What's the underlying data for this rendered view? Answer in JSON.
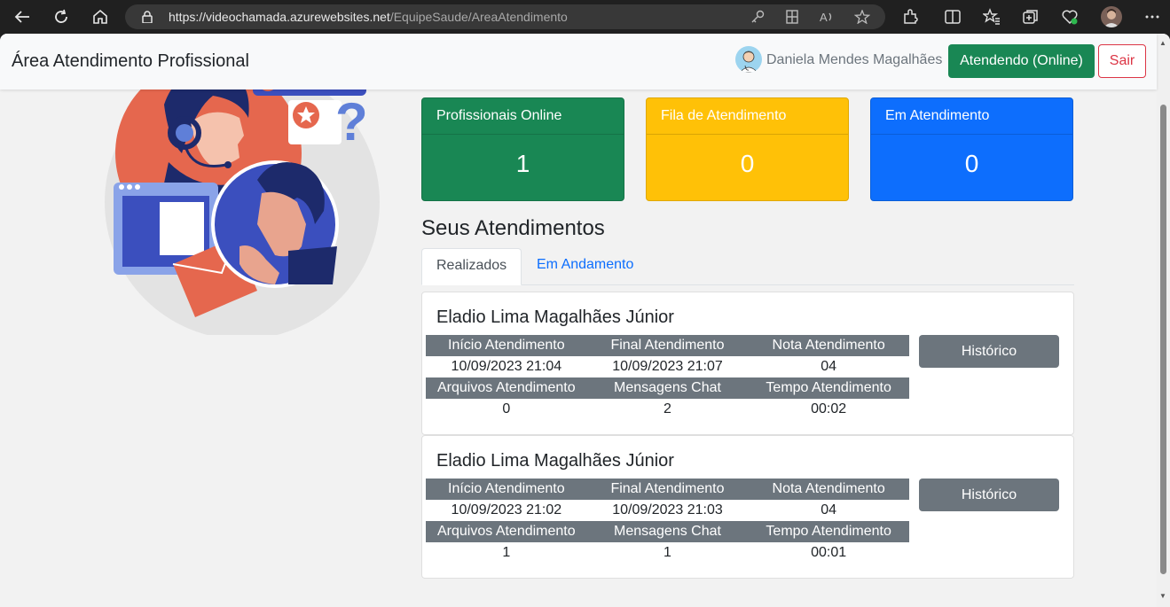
{
  "browser": {
    "url_host": "https://videochamada.azurewebsites.net",
    "url_path": "/EquipeSaude/AreaAtendimento"
  },
  "navbar": {
    "brand": "Área Atendimento Profissional",
    "user_name": "Daniela Mendes Magalhães",
    "status_button": "Atendendo (Online)",
    "logout_button": "Sair"
  },
  "stats": [
    {
      "label": "Profissionais Online",
      "value": "1",
      "color": "#198754"
    },
    {
      "label": "Fila de Atendimento",
      "value": "0",
      "color": "#ffc107"
    },
    {
      "label": "Em Atendimento",
      "value": "0",
      "color": "#0d6efd"
    }
  ],
  "section_title": "Seus Atendimentos",
  "tabs": [
    {
      "label": "Realizados",
      "active": true
    },
    {
      "label": "Em Andamento",
      "active": false
    }
  ],
  "labels": {
    "inicio": "Início Atendimento",
    "final": "Final Atendimento",
    "nota": "Nota Atendimento",
    "arquivos": "Arquivos Atendimento",
    "mensagens": "Mensagens Chat",
    "tempo": "Tempo Atendimento",
    "historico": "Histórico"
  },
  "sessions": [
    {
      "patient": "Eladio Lima Magalhães Júnior",
      "inicio": "10/09/2023 21:04",
      "final": "10/09/2023 21:07",
      "nota": "04",
      "arquivos": "0",
      "mensagens": "2",
      "tempo": "00:02"
    },
    {
      "patient": "Eladio Lima Magalhães Júnior",
      "inicio": "10/09/2023 21:02",
      "final": "10/09/2023 21:03",
      "nota": "04",
      "arquivos": "1",
      "mensagens": "1",
      "tempo": "00:01"
    }
  ]
}
